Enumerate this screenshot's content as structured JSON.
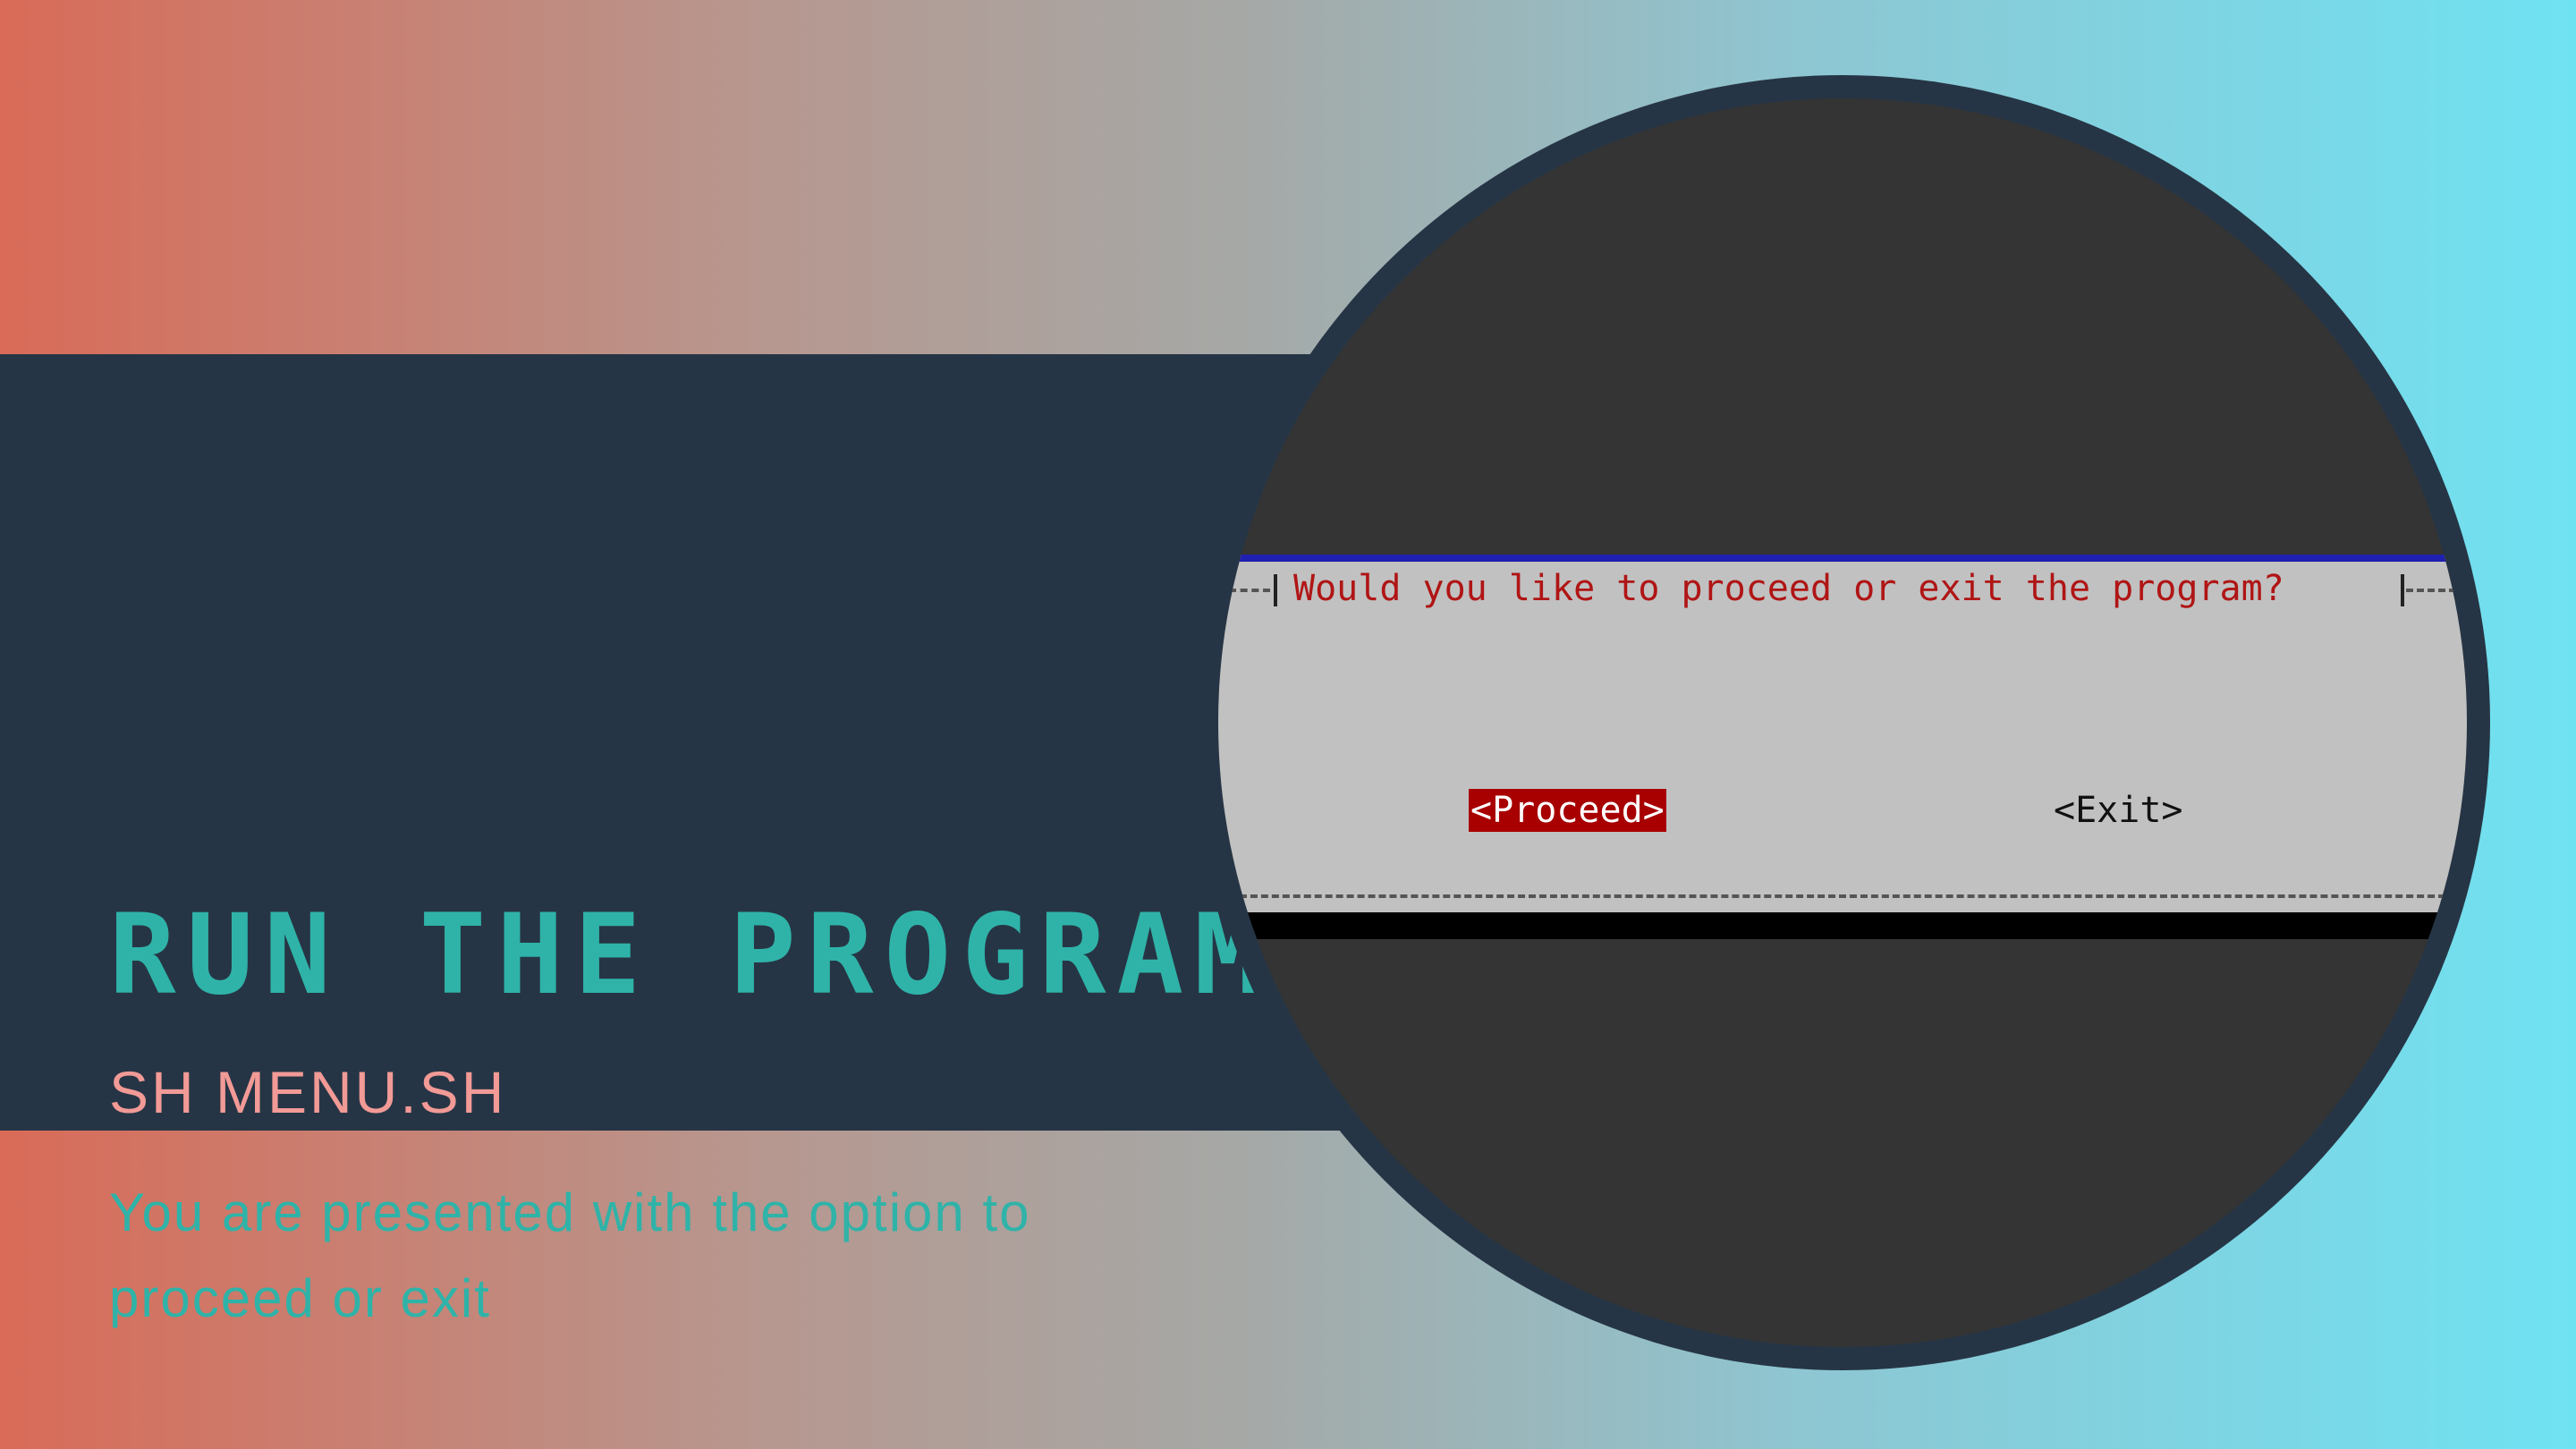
{
  "slide": {
    "title": "RUN THE PROGRAM",
    "subtitle": "SH MENU.SH",
    "description": "You are presented with the option to proceed or exit"
  },
  "terminal": {
    "dialog_title": "Would you like to proceed or exit the program?",
    "buttons": {
      "proceed_label": "<Proceed>",
      "exit_label": "<Exit>"
    },
    "selected_button": "proceed"
  },
  "colors": {
    "title": "#2fb3a8",
    "subtitle": "#f29a96",
    "band": "#263545",
    "dialog_bg": "#c1c1c1",
    "dialog_title_text": "#b01515",
    "selected_button_bg": "#a80000",
    "dialog_top_border": "#1f1fb0"
  }
}
